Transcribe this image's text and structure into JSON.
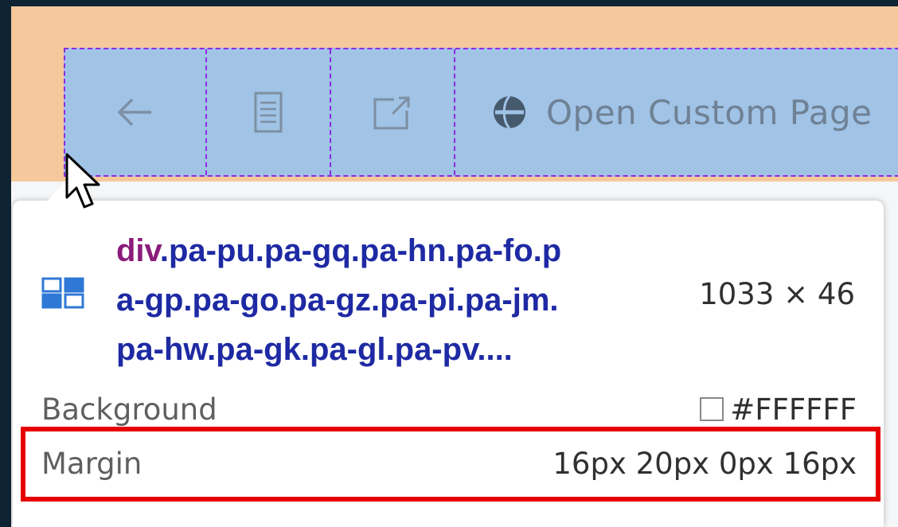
{
  "toolbar": {
    "open_label": "Open Custom Page",
    "back_icon": "arrow-left-icon",
    "doc_icon": "document-icon",
    "external_icon": "open-external-icon",
    "globe_icon": "globe-icon"
  },
  "tooltip": {
    "tag": "div",
    "class_line1": ".pa-pu.pa-gq.pa-hn.pa-fo.p",
    "class_line2": "a-gp.pa-go.pa-gz.pa-pi.pa-jm.",
    "class_line3": "pa-hw.pa-gk.pa-gl.pa-pv....",
    "dimensions": "1033 × 46",
    "rows": [
      {
        "label": "Background",
        "value": "#FFFFFF"
      },
      {
        "label": "Margin",
        "value": "16px 20px 0px 16px"
      }
    ]
  },
  "colors": {
    "margin_overlay": "#f5c99c",
    "content_overlay": "#a0c3e6",
    "dashed_border": "#8a2be2",
    "highlight_box": "#e60000",
    "selector_text": "#1e2aa3",
    "tag_text": "#8b1c7a"
  }
}
